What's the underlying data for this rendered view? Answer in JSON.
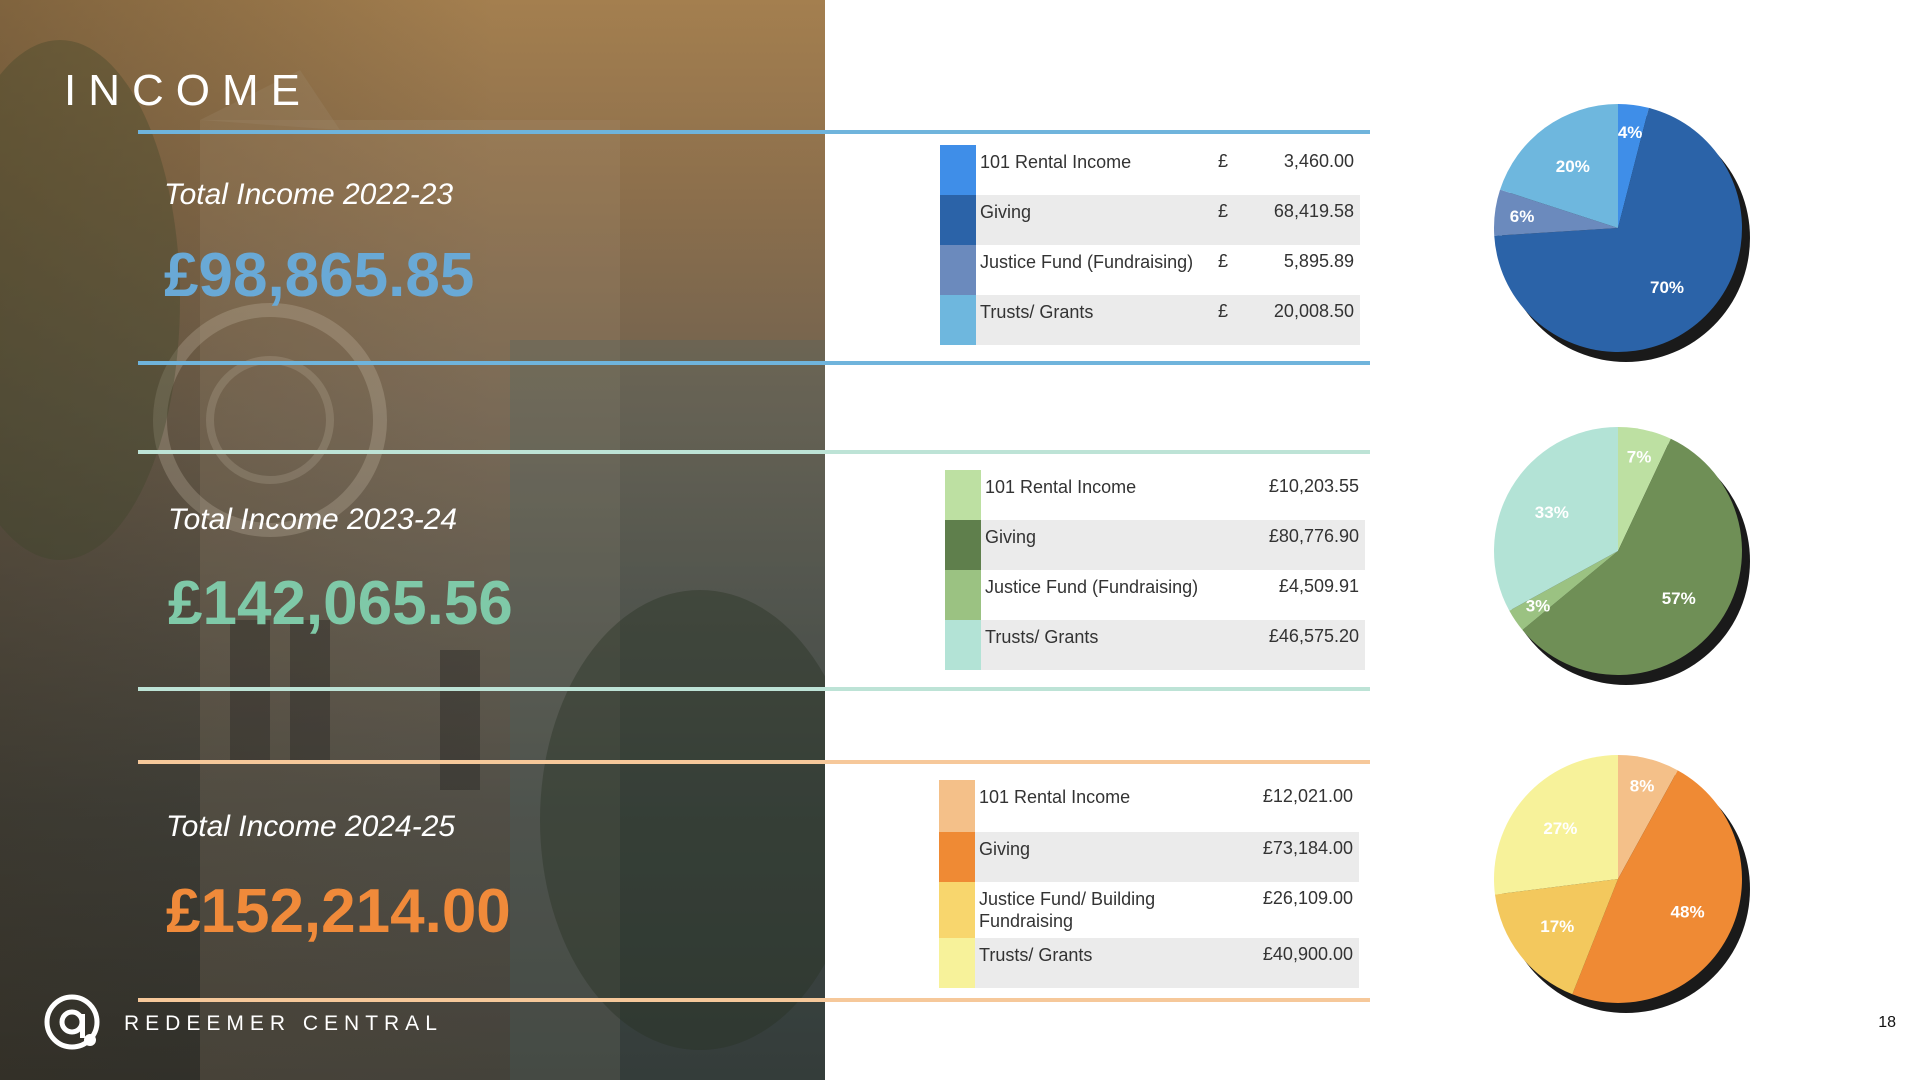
{
  "title": "INCOME",
  "brand": "REDEEMER CENTRAL",
  "page_number": "18",
  "colors": {
    "section1_accent": "#69a9d6",
    "section2_accent": "#7fc9a8",
    "section3_accent": "#f08a3a"
  },
  "sections": [
    {
      "label": "Total Income 2022-23",
      "total": "£98,865.85",
      "rows": [
        {
          "name": "101 Rental Income",
          "currency": "£",
          "amount": "3,460.00",
          "color": "#3f8ee8"
        },
        {
          "name": "Giving",
          "currency": "£",
          "amount": "68,419.58",
          "color": "#2b63a8"
        },
        {
          "name": "Justice Fund (Fundraising)",
          "currency": "£",
          "amount": "5,895.89",
          "color": "#6b8abd"
        },
        {
          "name": "Trusts/ Grants",
          "currency": "£",
          "amount": "20,008.50",
          "color": "#6eb7de"
        }
      ]
    },
    {
      "label": "Total Income 2023-24",
      "total": "£142,065.56",
      "rows": [
        {
          "name": "101 Rental Income",
          "currency": "",
          "amount": "£10,203.55",
          "color": "#bde0a2"
        },
        {
          "name": "Giving",
          "currency": "",
          "amount": "£80,776.90",
          "color": "#5f7f4c"
        },
        {
          "name": "Justice Fund (Fundraising)",
          "currency": "",
          "amount": "£4,509.91",
          "color": "#9bc282"
        },
        {
          "name": "Trusts/ Grants",
          "currency": "",
          "amount": "£46,575.20",
          "color": "#b3e3d6"
        }
      ]
    },
    {
      "label": "Total Income 2024-25",
      "total": "£152,214.00",
      "rows": [
        {
          "name": "101 Rental Income",
          "currency": "",
          "amount": "£12,021.00",
          "color": "#f4c089"
        },
        {
          "name": "Giving",
          "currency": "",
          "amount": "£73,184.00",
          "color": "#ef8a34"
        },
        {
          "name": "Justice Fund/ Building Fundraising",
          "currency": "",
          "amount": "£26,109.00",
          "color": "#f8d66d"
        },
        {
          "name": "Trusts/ Grants",
          "currency": "",
          "amount": "£40,900.00",
          "color": "#f7f29a"
        }
      ]
    }
  ],
  "chart_data": [
    {
      "type": "pie",
      "categories": [
        "101 Rental Income",
        "Giving",
        "Justice Fund (Fundraising)",
        "Trusts/ Grants"
      ],
      "values": [
        4,
        70,
        6,
        20
      ],
      "labels": [
        "4%",
        "70%",
        "6%",
        "20%"
      ],
      "colors": [
        "#3f8ee8",
        "#2b63a8",
        "#6b8abd",
        "#6eb7de"
      ]
    },
    {
      "type": "pie",
      "categories": [
        "101 Rental Income",
        "Giving",
        "Justice Fund (Fundraising)",
        "Trusts/ Grants"
      ],
      "values": [
        7,
        57,
        3,
        33
      ],
      "labels": [
        "7%",
        "57%",
        "3%",
        "33%"
      ],
      "colors": [
        "#bde0a2",
        "#6f8f56",
        "#9bc282",
        "#b3e3d6"
      ]
    },
    {
      "type": "pie",
      "categories": [
        "101 Rental Income",
        "Giving",
        "Justice Fund/ Building Fundraising",
        "Trusts/ Grants"
      ],
      "values": [
        8,
        48,
        17,
        27
      ],
      "labels": [
        "8%",
        "48%",
        "17%",
        "27%"
      ],
      "colors": [
        "#f4c089",
        "#ef8a34",
        "#f3c85d",
        "#f7f29a"
      ]
    }
  ]
}
